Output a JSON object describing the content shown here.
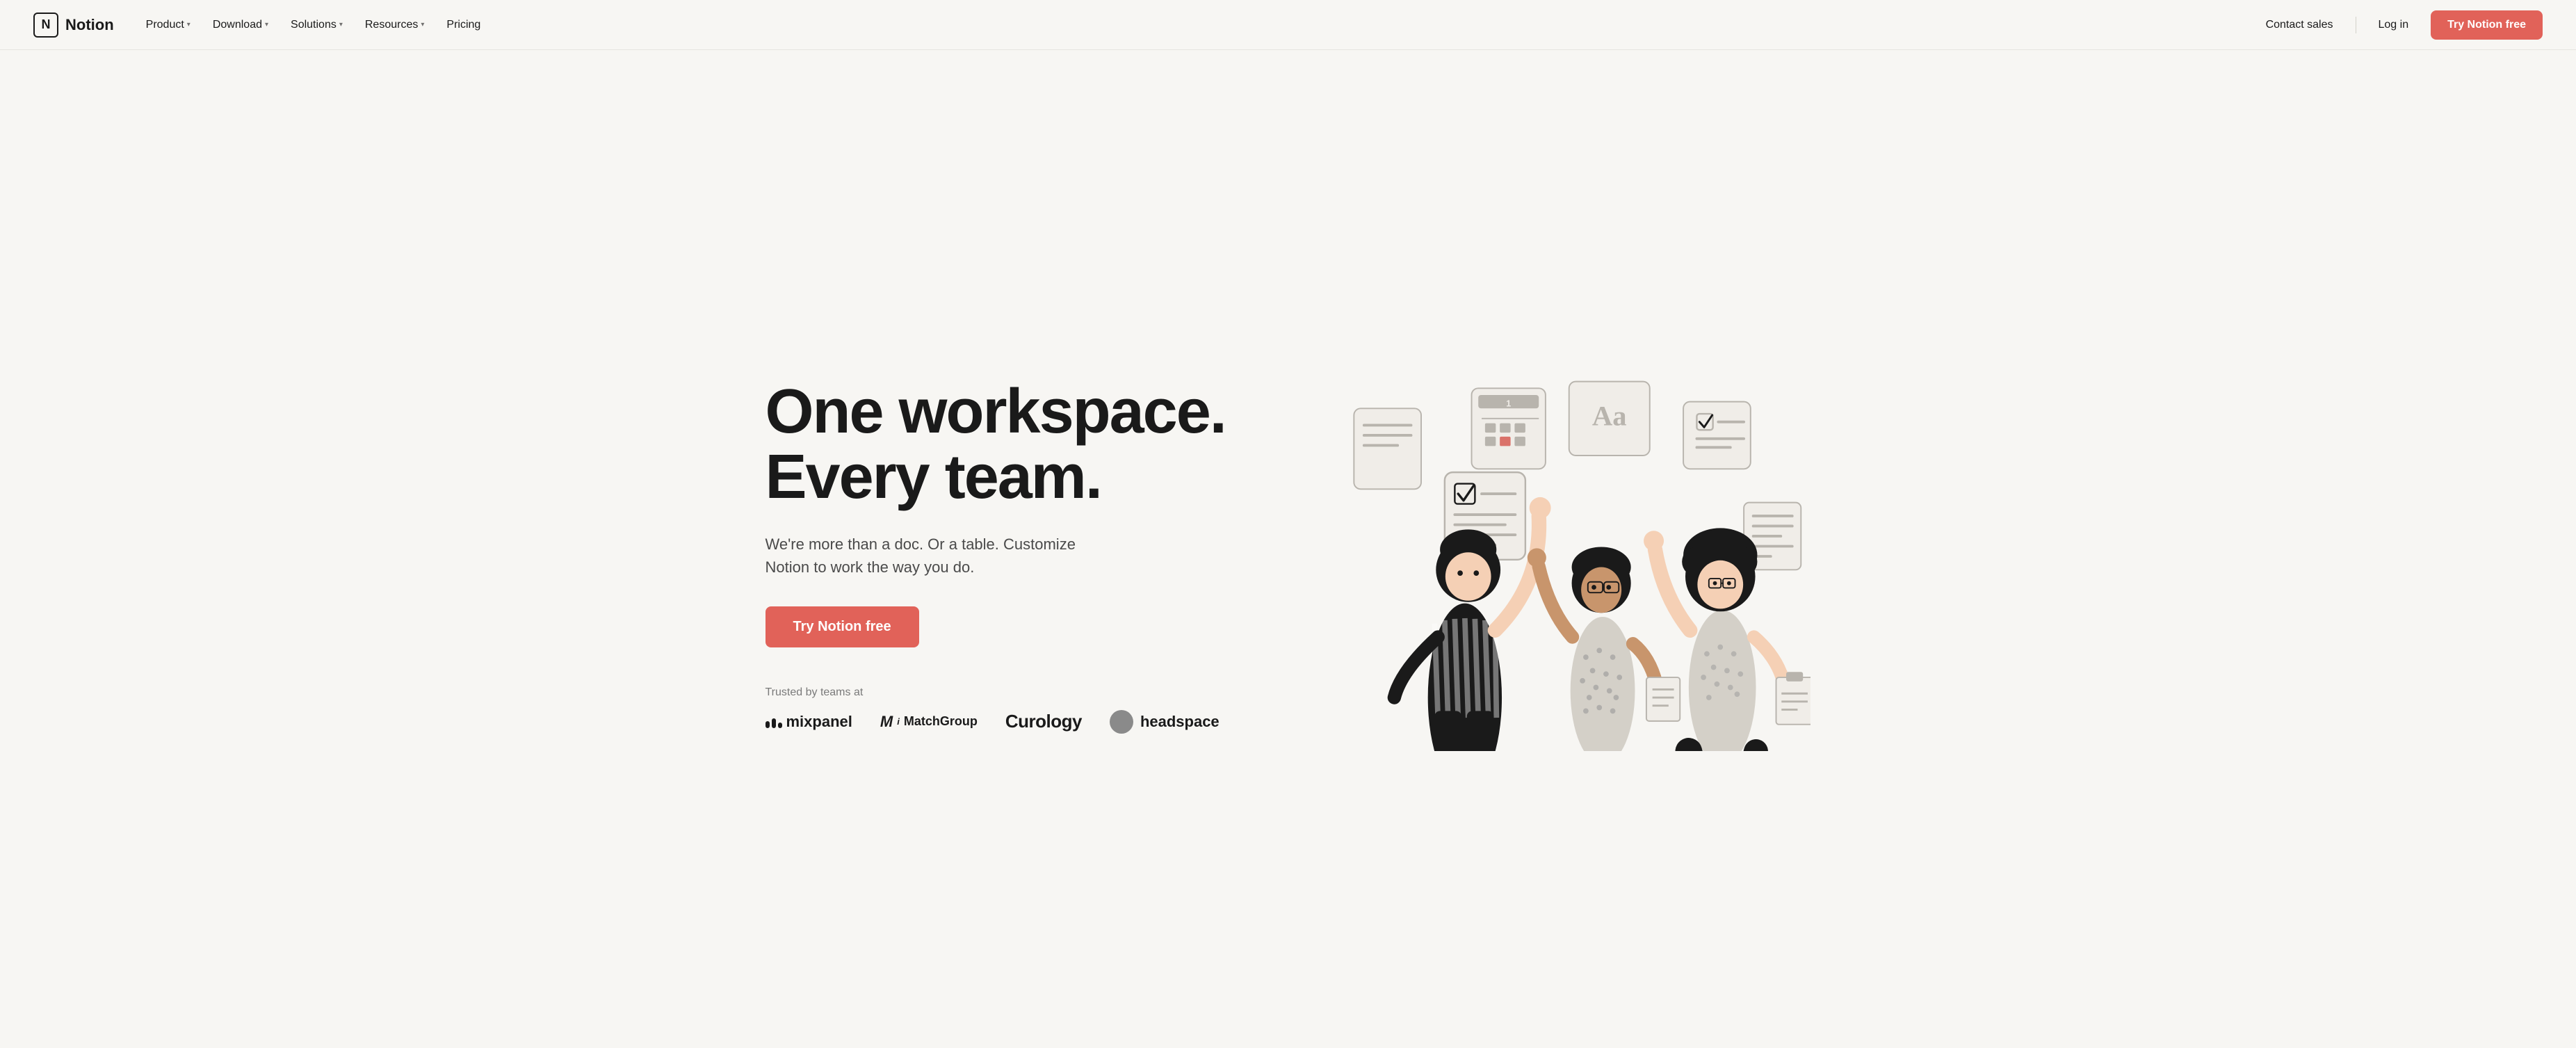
{
  "nav": {
    "logo_text": "Notion",
    "logo_icon": "N",
    "menu_items": [
      {
        "label": "Product",
        "has_dropdown": true
      },
      {
        "label": "Download",
        "has_dropdown": true
      },
      {
        "label": "Solutions",
        "has_dropdown": true
      },
      {
        "label": "Resources",
        "has_dropdown": true
      },
      {
        "label": "Pricing",
        "has_dropdown": false
      }
    ],
    "contact_sales_label": "Contact sales",
    "login_label": "Log in",
    "try_free_label": "Try Notion free"
  },
  "hero": {
    "title_line1": "One workspace.",
    "title_line2": "Every team.",
    "subtitle": "We're more than a doc. Or a table. Customize Notion to work the way you do.",
    "cta_label": "Try Notion free",
    "trusted_label": "Trusted by teams at",
    "logos": [
      {
        "name": "mixpanel",
        "text": "mixpanel"
      },
      {
        "name": "matchgroup",
        "text": "MatchGroup"
      },
      {
        "name": "curology",
        "text": "Curology"
      },
      {
        "name": "headspace",
        "text": "headspace"
      }
    ]
  },
  "colors": {
    "primary": "#e16259",
    "background": "#f7f6f3",
    "text_dark": "#1a1a1a",
    "text_medium": "#4a4a4a",
    "text_light": "#7a7a7a"
  }
}
